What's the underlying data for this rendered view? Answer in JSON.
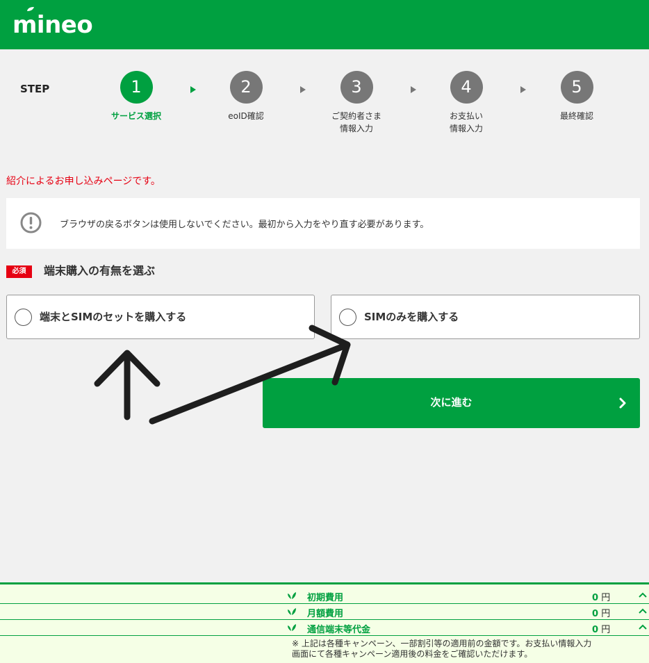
{
  "header": {
    "logo": "mineo",
    "brand_color": "#00a040"
  },
  "steps": {
    "label": "STEP",
    "items": [
      {
        "num": "1",
        "name": "サービス選択",
        "active": true
      },
      {
        "num": "2",
        "name": "eoID確認",
        "active": false
      },
      {
        "num": "3",
        "name": "ご契約者さま\n情報入力",
        "active": false
      },
      {
        "num": "4",
        "name": "お支払い\n情報入力",
        "active": false
      },
      {
        "num": "5",
        "name": "最終確認",
        "active": false
      }
    ]
  },
  "referral_text": "紹介によるお申し込みページです。",
  "notice": {
    "icon": "exclamation-circle-icon",
    "text": "ブラウザの戻るボタンは使用しないでください。最初から入力をやり直す必要があります。"
  },
  "section": {
    "required_badge": "必須",
    "title": "端末購入の有無を選ぶ"
  },
  "options": [
    {
      "label": "端末とSIMのセットを購入する"
    },
    {
      "label": "SIMのみを購入する"
    }
  ],
  "next_button": {
    "label": "次に進む",
    "icon": "chevron-right-icon"
  },
  "summary": {
    "rows": [
      {
        "label": "初期費用",
        "value": "0",
        "unit": "円"
      },
      {
        "label": "月額費用",
        "value": "0",
        "unit": "円"
      },
      {
        "label": "通信端末等代金",
        "value": "0",
        "unit": "円"
      }
    ],
    "note": "※ 上記は各種キャンペーン、一部割引等の適用前の金額です。お支払い情報入力画面にて各種キャンペーン適用後の料金をご確認いただけます。"
  }
}
